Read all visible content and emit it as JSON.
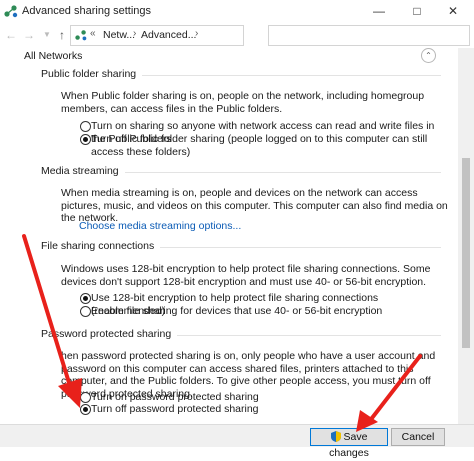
{
  "window": {
    "title": "Advanced sharing settings"
  },
  "address": {
    "crumb_prefix": "«",
    "crumb1": "Netw...",
    "separator": "›",
    "crumb2": "Advanced...",
    "separator2": "›"
  },
  "section_all": {
    "label": "All Networks"
  },
  "public_folder": {
    "title": "Public folder sharing",
    "description": "When Public folder sharing is on, people on the network, including homegroup members, can access files in the Public folders.",
    "option_on": "Turn on sharing so anyone with network access can read and write files in the Public folders",
    "option_off": "Turn off Public folder sharing (people logged on to this computer can still access these folders)"
  },
  "media": {
    "title": "Media streaming",
    "description": "When media streaming is on, people and devices on the network can access pictures, music, and videos on this computer. This computer can also find media on the network.",
    "link": "Choose media streaming options..."
  },
  "file_sharing": {
    "title": "File sharing connections",
    "description": "Windows uses 128-bit encryption to help protect file sharing connections. Some devices don't support 128-bit encryption and must use 40- or 56-bit encryption.",
    "option_128": "Use 128-bit encryption to help protect file sharing connections (recommended)",
    "option_40": "Enable file sharing for devices that use 40- or 56-bit encryption"
  },
  "password": {
    "title": "Password protected sharing",
    "description": "hen password protected sharing is on, only people who have a user account and password on this computer can access shared files, printers attached to this computer, and the Public folders. To give other people access, you must turn off password protected sharing.",
    "option_on": "Turn on password protected sharing",
    "option_off": "Turn off password protected sharing"
  },
  "footer": {
    "save_label": "Save changes",
    "cancel_label": "Cancel"
  },
  "colors": {
    "link": "#0b5bb5",
    "arrow": "#e8211b",
    "primary_border": "#0078d7"
  },
  "icons": {
    "app": "network-share-icon",
    "back": "back-arrow-icon",
    "forward": "forward-arrow-icon",
    "up": "up-arrow-icon",
    "shield": "uac-shield-icon"
  }
}
